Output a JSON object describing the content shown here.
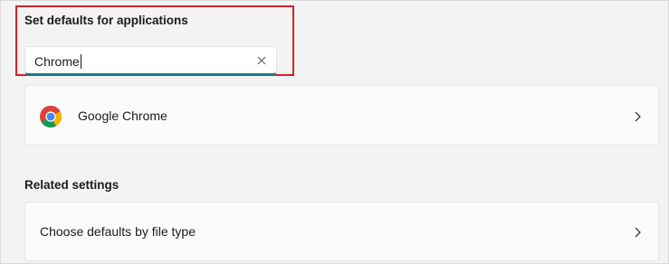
{
  "defaults_section": {
    "title": "Set defaults for applications",
    "search": {
      "value": "Chrome",
      "clear_icon": "close-icon"
    }
  },
  "results": [
    {
      "label": "Google Chrome",
      "icon": "chrome-logo-icon",
      "trailing_icon": "chevron-right-icon"
    }
  ],
  "related_section": {
    "title": "Related settings",
    "items": [
      {
        "label": "Choose defaults by file type",
        "trailing_icon": "chevron-right-icon"
      }
    ]
  },
  "colors": {
    "highlight": "#d2232a",
    "search_underline": "#1f7a8c",
    "background": "#f3f3f3",
    "card": "#fbfbfb"
  }
}
